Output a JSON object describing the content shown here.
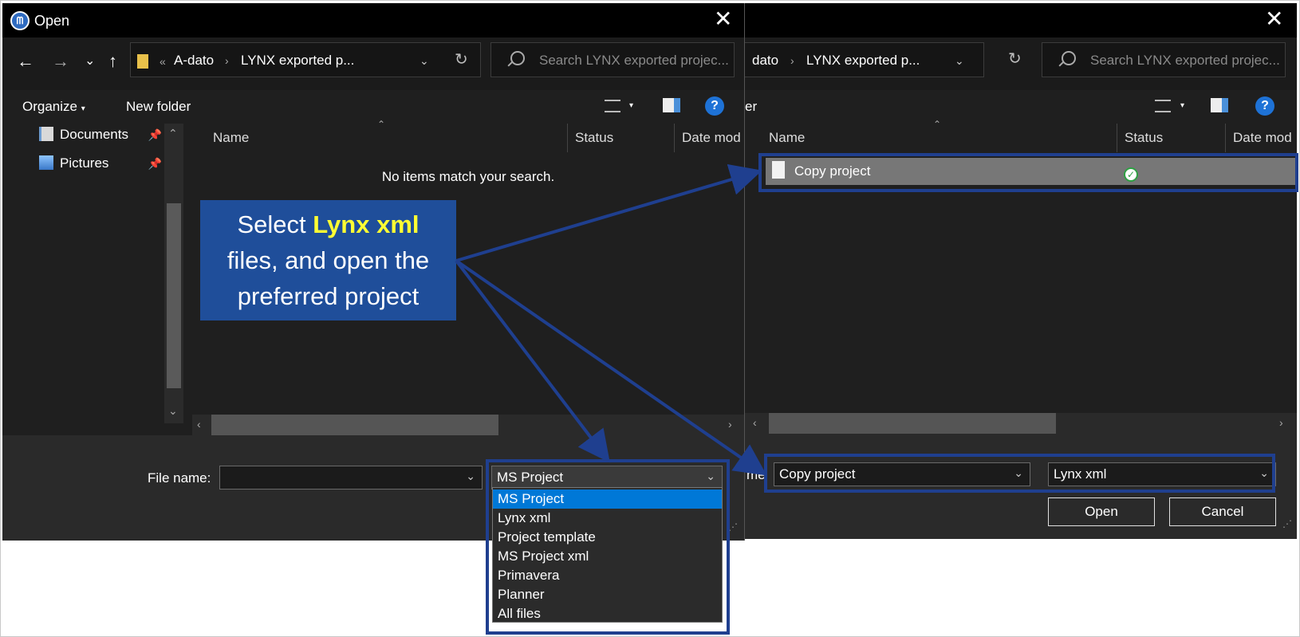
{
  "left_dialog": {
    "title": "Open",
    "address": {
      "overflow": "«",
      "crumb1": "A-dato",
      "crumb2": "LYNX exported p..."
    },
    "search_placeholder": "Search LYNX exported projec...",
    "toolbar": {
      "organize": "Organize",
      "new_folder": "New folder"
    },
    "nav": [
      {
        "label": "Documents",
        "icon": "documents-icon"
      },
      {
        "label": "Pictures",
        "icon": "pictures-icon"
      }
    ],
    "columns": {
      "name": "Name",
      "status": "Status",
      "date": "Date mod"
    },
    "empty_message": "No items match your search.",
    "file_name_label": "File name:",
    "file_name_value": "",
    "file_type_value": "MS Project",
    "file_type_options": [
      "MS Project",
      "Lynx xml",
      "Project template",
      "MS Project xml",
      "Primavera",
      "Planner",
      "All files"
    ],
    "file_type_selected_index": 0
  },
  "right_dialog": {
    "address": {
      "crumb1": "dato",
      "crumb2": "LYNX exported p..."
    },
    "search_placeholder": "Search LYNX exported projec...",
    "toolbar_fragment": "er",
    "columns": {
      "name": "Name",
      "status": "Status",
      "date": "Date mod"
    },
    "files": [
      {
        "name": "Copy project",
        "status": "synced",
        "status_icon": "check-circle-icon"
      }
    ],
    "file_name_label_fragment": "me",
    "file_name_value": "Copy project",
    "file_type_value": "Lynx xml",
    "open_button": "Open",
    "cancel_button": "Cancel"
  },
  "callout": {
    "prefix": "Select ",
    "highlight": "Lynx xml",
    "line2": "files, and open the",
    "line3": "preferred project"
  },
  "colors": {
    "highlight_border": "#1f3f8f",
    "callout_bg": "#1f4e9a",
    "callout_highlight": "#ffff33",
    "selection": "#0078d7"
  }
}
